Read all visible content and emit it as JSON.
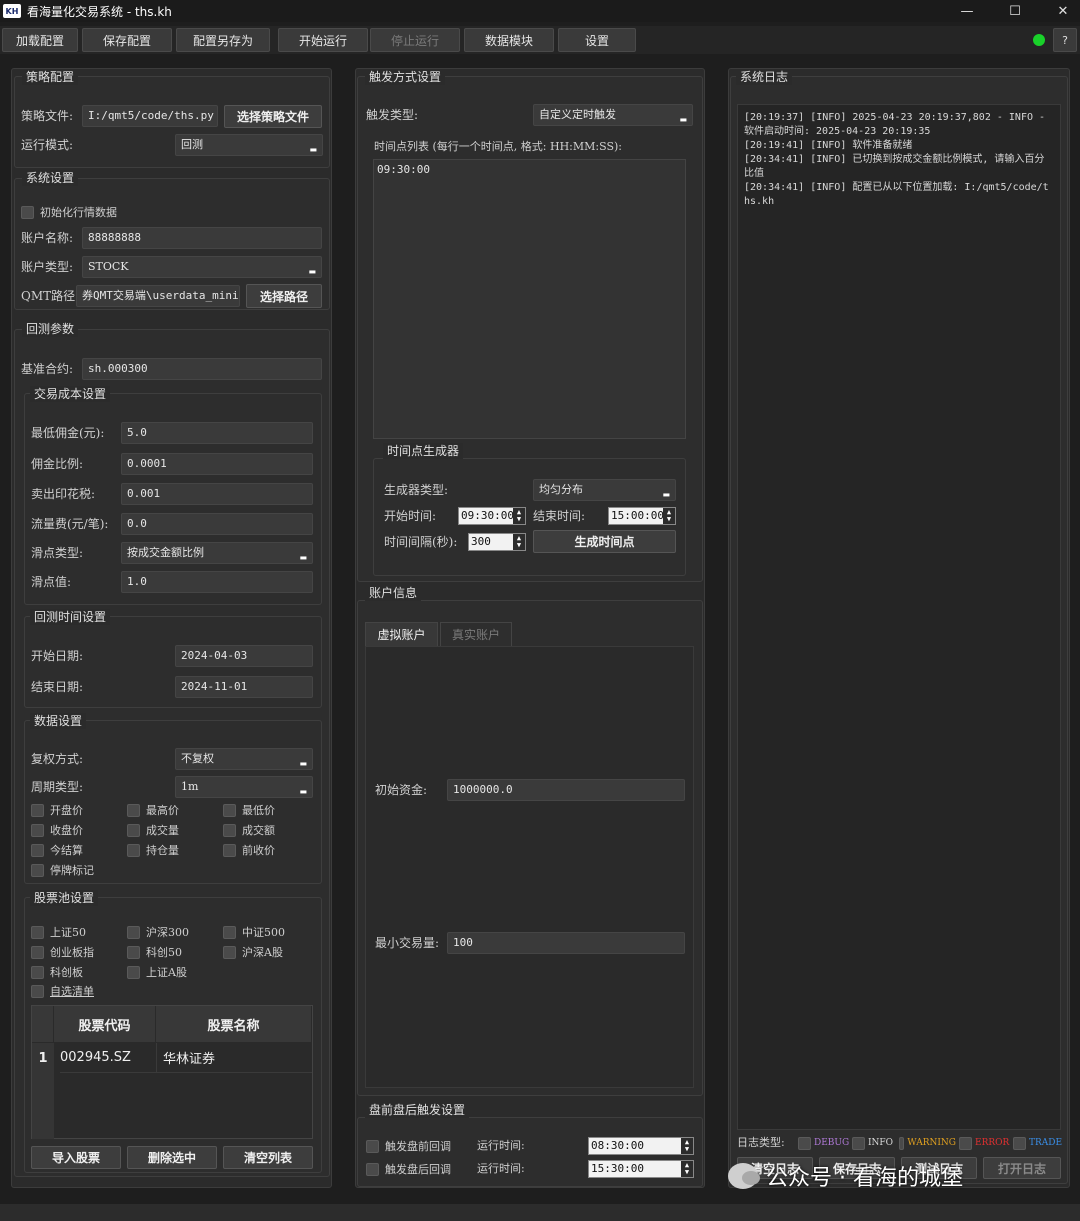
{
  "window": {
    "app_icon_text": "KH",
    "title": "看海量化交易系统 - ths.kh",
    "minimize": "—",
    "maximize": "☐",
    "close": "✕"
  },
  "toolbar": {
    "load": "加载配置",
    "save": "保存配置",
    "save_as": "配置另存为",
    "start": "开始运行",
    "stop": "停止运行",
    "data": "数据模块",
    "settings": "设置",
    "help": "?",
    "status_color": "#19d12a"
  },
  "strategy": {
    "title": "策略配置",
    "file_label": "策略文件:",
    "file_value": "I:/qmt5/code/ths.py",
    "choose_button": "选择策略文件",
    "mode_label": "运行模式:",
    "mode_value": "回测"
  },
  "system": {
    "title": "系统设置",
    "init_data": "初始化行情数据",
    "account_label": "账户名称:",
    "account_value": "88888888",
    "type_label": "账户类型:",
    "type_value": "STOCK",
    "qmt_label": "QMT路径:",
    "qmt_value": "券QMT交易端\\userdata_mini",
    "choose_path": "选择路径"
  },
  "backtest": {
    "title": "回测参数",
    "benchmark_label": "基准合约:",
    "benchmark_value": "sh.000300",
    "cost": {
      "title": "交易成本设置",
      "min_commission_label": "最低佣金(元):",
      "min_commission_value": "5.0",
      "commission_label": "佣金比例:",
      "commission_value": "0.0001",
      "stamp_label": "卖出印花税:",
      "stamp_value": "0.001",
      "flow_label": "流量费(元/笔):",
      "flow_value": "0.0",
      "slip_type_label": "滑点类型:",
      "slip_type_value": "按成交金额比例",
      "slip_value_label": "滑点值:",
      "slip_value": "1.0"
    },
    "time": {
      "title": "回测时间设置",
      "start_label": "开始日期:",
      "start_value": "2024-04-03",
      "end_label": "结束日期:",
      "end_value": "2024-11-01"
    },
    "data": {
      "title": "数据设置",
      "adjust_label": "复权方式:",
      "adjust_value": "不复权",
      "period_label": "周期类型:",
      "period_value": "1m",
      "fields": [
        "开盘价",
        "最高价",
        "最低价",
        "收盘价",
        "成交量",
        "成交额",
        "今结算",
        "持仓量",
        "前收价",
        "停牌标记"
      ]
    },
    "pool": {
      "title": "股票池设置",
      "items": [
        "上证50",
        "沪深300",
        "中证500",
        "创业板指",
        "科创50",
        "沪深A股",
        "科创板",
        "上证A股",
        "自选清单"
      ],
      "headers": [
        "股票代码",
        "股票名称"
      ],
      "rows": [
        {
          "index": "1",
          "code": "002945.SZ",
          "name": "华林证券"
        }
      ],
      "import": "导入股票",
      "delete": "删除选中",
      "clear": "清空列表"
    }
  },
  "trigger": {
    "title": "触发方式设置",
    "type_label": "触发类型:",
    "type_value": "自定义定时触发",
    "list_label": "时间点列表 (每行一个时间点, 格式: HH:MM:SS):",
    "list_value": "09:30:00",
    "generator": {
      "title": "时间点生成器",
      "type_label": "生成器类型:",
      "type_value": "均匀分布",
      "start_label": "开始时间:",
      "start_value": "09:30:00",
      "end_label": "结束时间:",
      "end_value": "15:00:00",
      "interval_label": "时间间隔(秒):",
      "interval_value": "300",
      "generate": "生成时间点"
    }
  },
  "account": {
    "title": "账户信息",
    "tab_virtual": "虚拟账户",
    "tab_real": "真实账户",
    "capital_label": "初始资金:",
    "capital_value": "1000000.0",
    "min_trade_label": "最小交易量:",
    "min_trade_value": "100"
  },
  "prepost": {
    "title": "盘前盘后触发设置",
    "pre_label": "触发盘前回调",
    "pre_time_label": "运行时间:",
    "pre_time": "08:30:00",
    "post_label": "触发盘后回调",
    "post_time_label": "运行时间:",
    "post_time": "15:30:00"
  },
  "log": {
    "title": "系统日志",
    "lines": [
      "[20:19:37] [INFO] 2025-04-23 20:19:37,802 - INFO - 软件启动时间: 2025-04-23 20:19:35",
      "[20:19:41] [INFO] 软件准备就绪",
      "[20:34:41] [INFO] 已切换到按成交金额比例模式, 请输入百分比值",
      "[20:34:41] [INFO] 配置已从以下位置加载: I:/qmt5/code/ths.kh"
    ],
    "type_label": "日志类型:",
    "types": [
      {
        "name": "DEBUG",
        "color": "#b07ad8"
      },
      {
        "name": "INFO",
        "color": "#d8d8d8"
      },
      {
        "name": "WARNING",
        "color": "#e0a020"
      },
      {
        "name": "ERROR",
        "color": "#e03030"
      },
      {
        "name": "TRADE",
        "color": "#3a8ee6"
      }
    ],
    "clear": "清空日志",
    "save": "保存日志",
    "test": "测试日志",
    "open": "打开日志"
  },
  "watermark": {
    "text": "公众号 · 看海的城堡"
  }
}
